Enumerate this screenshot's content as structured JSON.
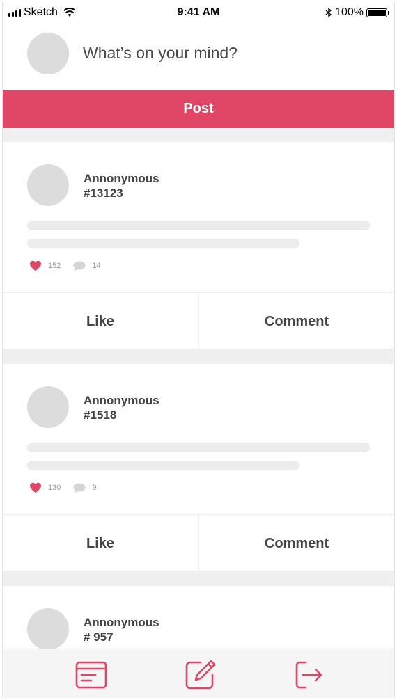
{
  "status_bar": {
    "carrier": "Sketch",
    "time": "9:41 AM",
    "battery": "100%"
  },
  "composer": {
    "placeholder": "What’s on your mind?",
    "post_label": "Post"
  },
  "posts": [
    {
      "author_line1": "Annonymous",
      "author_line2": "#13123",
      "likes": "152",
      "comments": "14",
      "like_label": "Like",
      "comment_label": "Comment"
    },
    {
      "author_line1": "Annonymous",
      "author_line2": "#1518",
      "likes": "130",
      "comments": "9",
      "like_label": "Like",
      "comment_label": "Comment"
    },
    {
      "author_line1": "Annonymous",
      "author_line2": "# 957"
    }
  ],
  "tab_bar": {
    "items": [
      {
        "icon": "feed-icon"
      },
      {
        "icon": "compose-icon"
      },
      {
        "icon": "logout-icon"
      }
    ]
  },
  "colors": {
    "accent": "#e04766",
    "avatar": "#dcdcdc",
    "skeleton": "#ececec",
    "divider": "#efefef"
  }
}
